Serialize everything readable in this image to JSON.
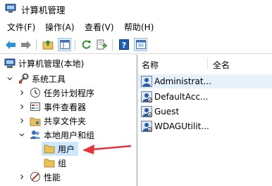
{
  "window": {
    "title": "计算机管理"
  },
  "menu": {
    "file": "文件(F)",
    "action": "操作(A)",
    "view": "查看(V)",
    "help": "帮助(H)"
  },
  "tree": {
    "root": "计算机管理(本地)",
    "system_tools": "系统工具",
    "task_scheduler": "任务计划程序",
    "event_viewer": "事件查看器",
    "shared_folders": "共享文件夹",
    "local_users_groups": "本地用户和组",
    "users": "用户",
    "groups": "组",
    "performance": "性能"
  },
  "list": {
    "columns": {
      "name": "名称",
      "full_name": "全名"
    },
    "rows": [
      "Administrat...",
      "DefaultAcc...",
      "Guest",
      "WDAGUtilit..."
    ]
  },
  "colors": {
    "accent_red": "#e8333a",
    "selection": "#cce8ff"
  },
  "icons": [
    "app-icon",
    "back-arrow-icon",
    "forward-arrow-icon",
    "up-folder-icon",
    "console-tree-icon",
    "refresh-icon",
    "export-icon",
    "help-icon",
    "mmc-icon",
    "computer-icon",
    "tools-icon",
    "clock-icon",
    "event-viewer-icon",
    "shared-folder-icon",
    "users-group-icon",
    "folder-icon",
    "performance-icon",
    "user-icon"
  ]
}
